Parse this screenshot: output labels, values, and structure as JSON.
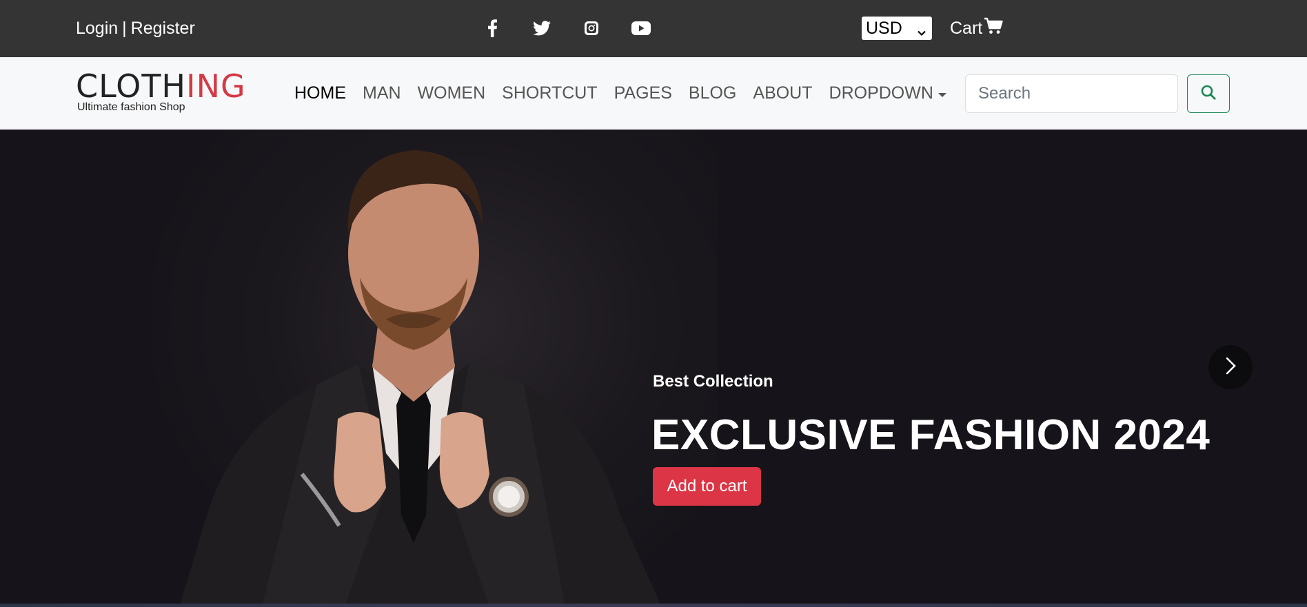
{
  "topbar": {
    "login": "Login",
    "separator": "|",
    "register": "Register",
    "social": [
      "facebook-icon",
      "twitter-icon",
      "instagram-icon",
      "youtube-icon"
    ],
    "currency": "USD",
    "cart_label": "Cart"
  },
  "navbar": {
    "logo_dark_1": "CL",
    "logo_dark_2": "OTH",
    "logo_red": "ING",
    "logo_tagline": "Ultimate fashion Shop",
    "menu": [
      "HOME",
      "MAN",
      "WOMEN",
      "SHORTCUT",
      "PAGES",
      "BLOG",
      "ABOUT",
      "DROPDOWN"
    ],
    "search_placeholder": "Search"
  },
  "hero": {
    "eyebrow": "Best Collection",
    "headline": "EXCLUSIVE FASHION 2024",
    "cta": "Add to cart"
  },
  "colors": {
    "topbar_bg": "#343434",
    "navbar_bg": "#f7f8f9",
    "accent_red": "#dc3545",
    "search_green": "#198754",
    "hero_bg": "#16141a"
  }
}
